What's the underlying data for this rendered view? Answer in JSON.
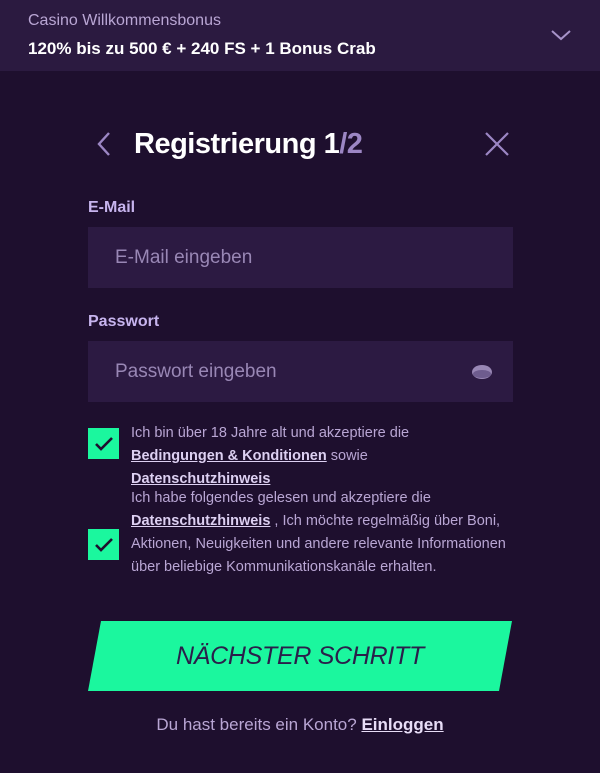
{
  "bonus": {
    "subtitle": "Casino Willkommensbonus",
    "title": "120% bis zu 500 € + 240 FS + 1 Bonus Crab"
  },
  "header": {
    "title": "Registrierung",
    "step_current": "1",
    "step_sep": "/",
    "step_total": "2"
  },
  "form": {
    "email_label": "E-Mail",
    "email_placeholder": "E-Mail eingeben",
    "password_label": "Passwort",
    "password_placeholder": "Passwort eingeben"
  },
  "consent": {
    "terms": {
      "checked": true,
      "text_before": "Ich bin über 18 Jahre alt und akzeptiere die",
      "link_terms": "Bedingungen & Konditionen",
      "text_middle": "sowie",
      "link_privacy": "Datenschutzhinweis"
    },
    "marketing": {
      "checked": true,
      "text_before": "Ich habe folgendes gelesen und akzeptiere die",
      "link_privacy": "Datenschutzhinweis",
      "text_after": ", Ich möchte regelmäßig über Boni, Aktionen, Neuigkeiten und andere relevante Informationen über beliebige Kommunikationskanäle erhalten."
    }
  },
  "actions": {
    "next_label": "NÄCHSTER SCHRITT",
    "login_prompt": "Du hast bereits ein Konto?",
    "login_link": "Einloggen"
  },
  "colors": {
    "background": "#1e0f2e",
    "bonus_bar": "#2b1a40",
    "input_bg": "#2c1a42",
    "accent": "#1bf79e",
    "label": "#c7b4ee"
  },
  "icons": {
    "bonus_toggle": "chevron-down-icon",
    "back": "chevron-left-icon",
    "close": "close-icon",
    "password_visibility": "eye-icon",
    "checkbox": "check-icon"
  }
}
